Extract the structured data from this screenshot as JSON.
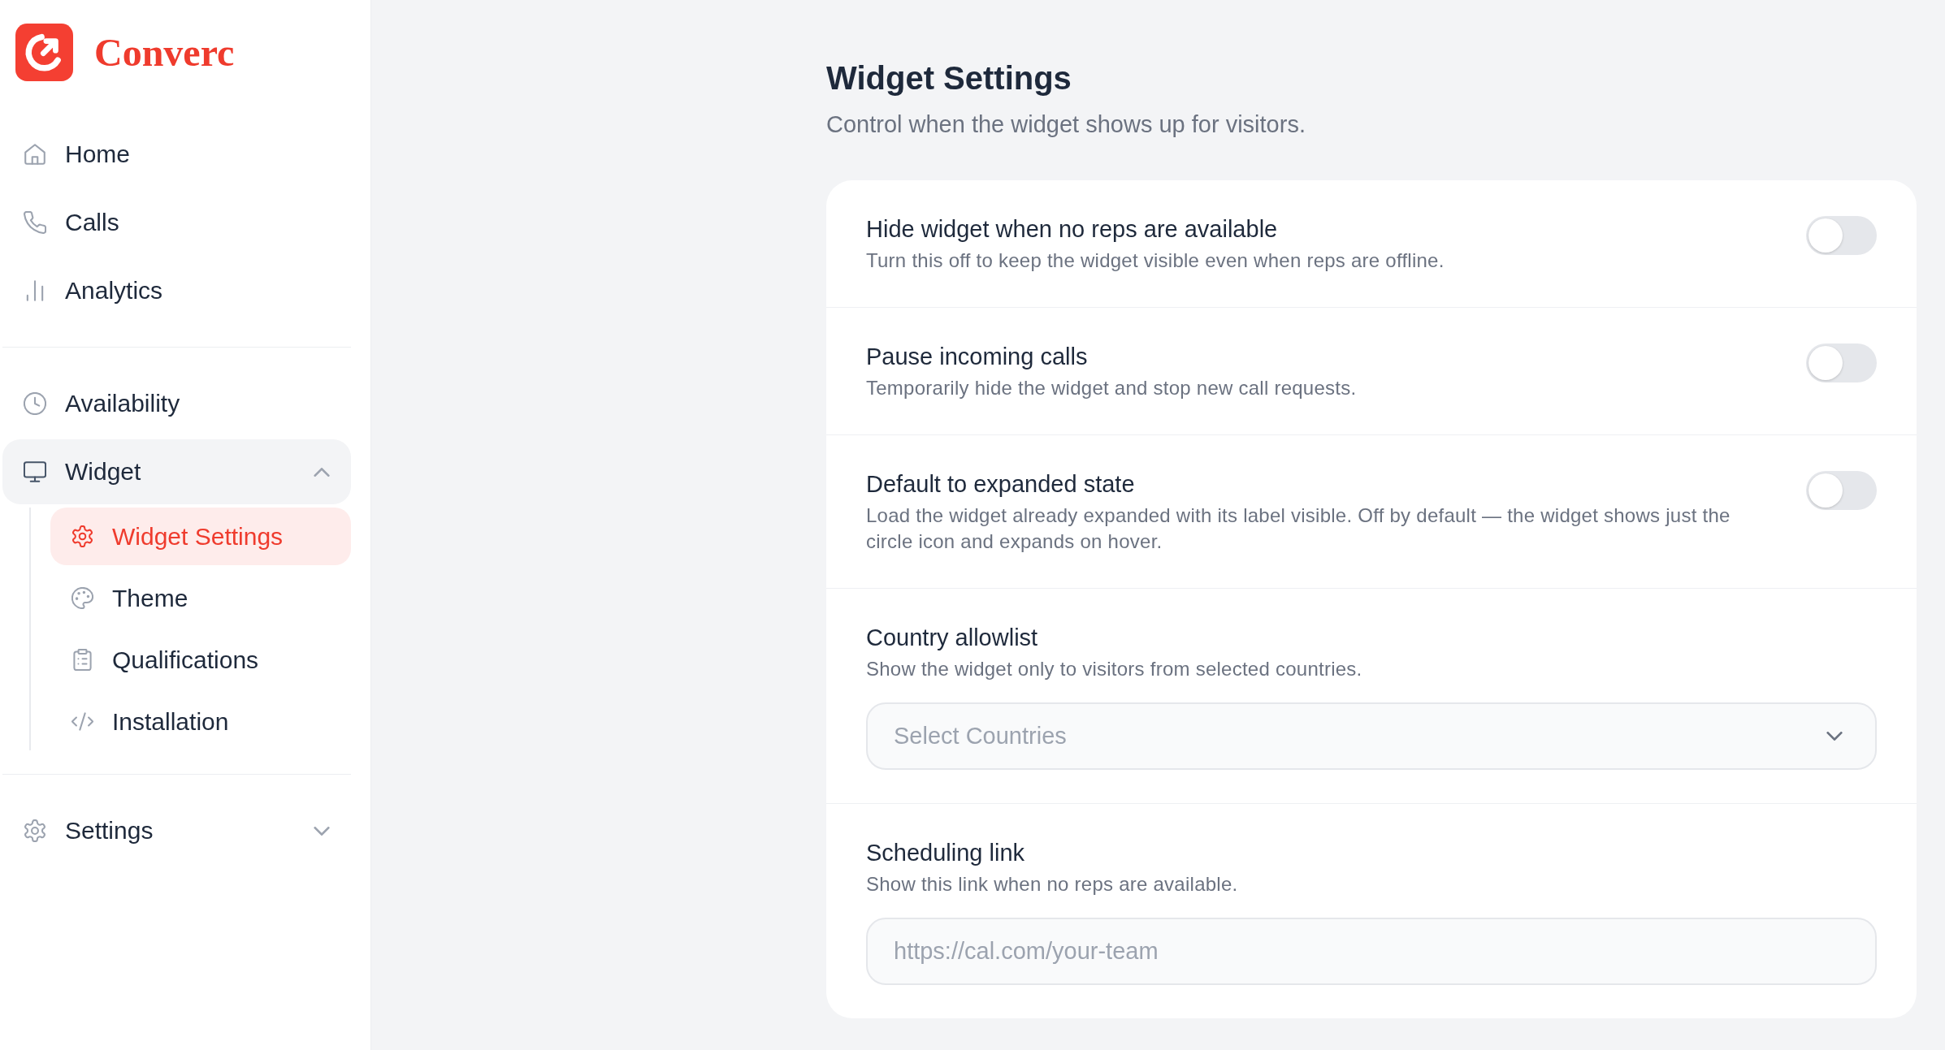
{
  "sidebar": {
    "brand": "Converc",
    "sections": [
      {
        "items": [
          {
            "label": "Home",
            "selected": false
          },
          {
            "label": "Calls",
            "selected": false
          },
          {
            "label": "Analytics",
            "selected": false
          }
        ]
      },
      {
        "items": [
          {
            "label": "Availability",
            "selected": false
          },
          {
            "label": "Widget",
            "selected": false,
            "expanded": true,
            "children": [
              {
                "label": "Widget Settings",
                "selected": true
              },
              {
                "label": "Theme",
                "selected": false
              },
              {
                "label": "Qualifications",
                "selected": false
              },
              {
                "label": "Installation",
                "selected": false
              }
            ]
          }
        ]
      },
      {
        "items": [
          {
            "label": "Settings",
            "selected": false,
            "expanded": false
          }
        ]
      }
    ]
  },
  "header": {
    "title": "Widget Settings",
    "subtitle": "Control when the widget shows up for visitors."
  },
  "settings": [
    {
      "kind": "toggle",
      "title": "Hide widget when no reps are available",
      "description": "Turn this off to keep the widget visible even when reps are offline.",
      "on": false
    },
    {
      "kind": "toggle",
      "title": "Pause incoming calls",
      "description": "Temporarily hide the widget and stop new call requests.",
      "on": false
    },
    {
      "kind": "toggle",
      "title": "Default to expanded state",
      "description": "Load the widget already expanded with its label visible. Off by default — the widget shows just the circle icon and expands on hover.",
      "on": false
    },
    {
      "kind": "select",
      "title": "Country allowlist",
      "description": "Show the widget only to visitors from selected countries.",
      "placeholder": "Select Countries"
    },
    {
      "kind": "input",
      "title": "Scheduling link",
      "description": "Show this link when no reps are available.",
      "placeholder": "https://cal.com/your-team"
    }
  ]
}
